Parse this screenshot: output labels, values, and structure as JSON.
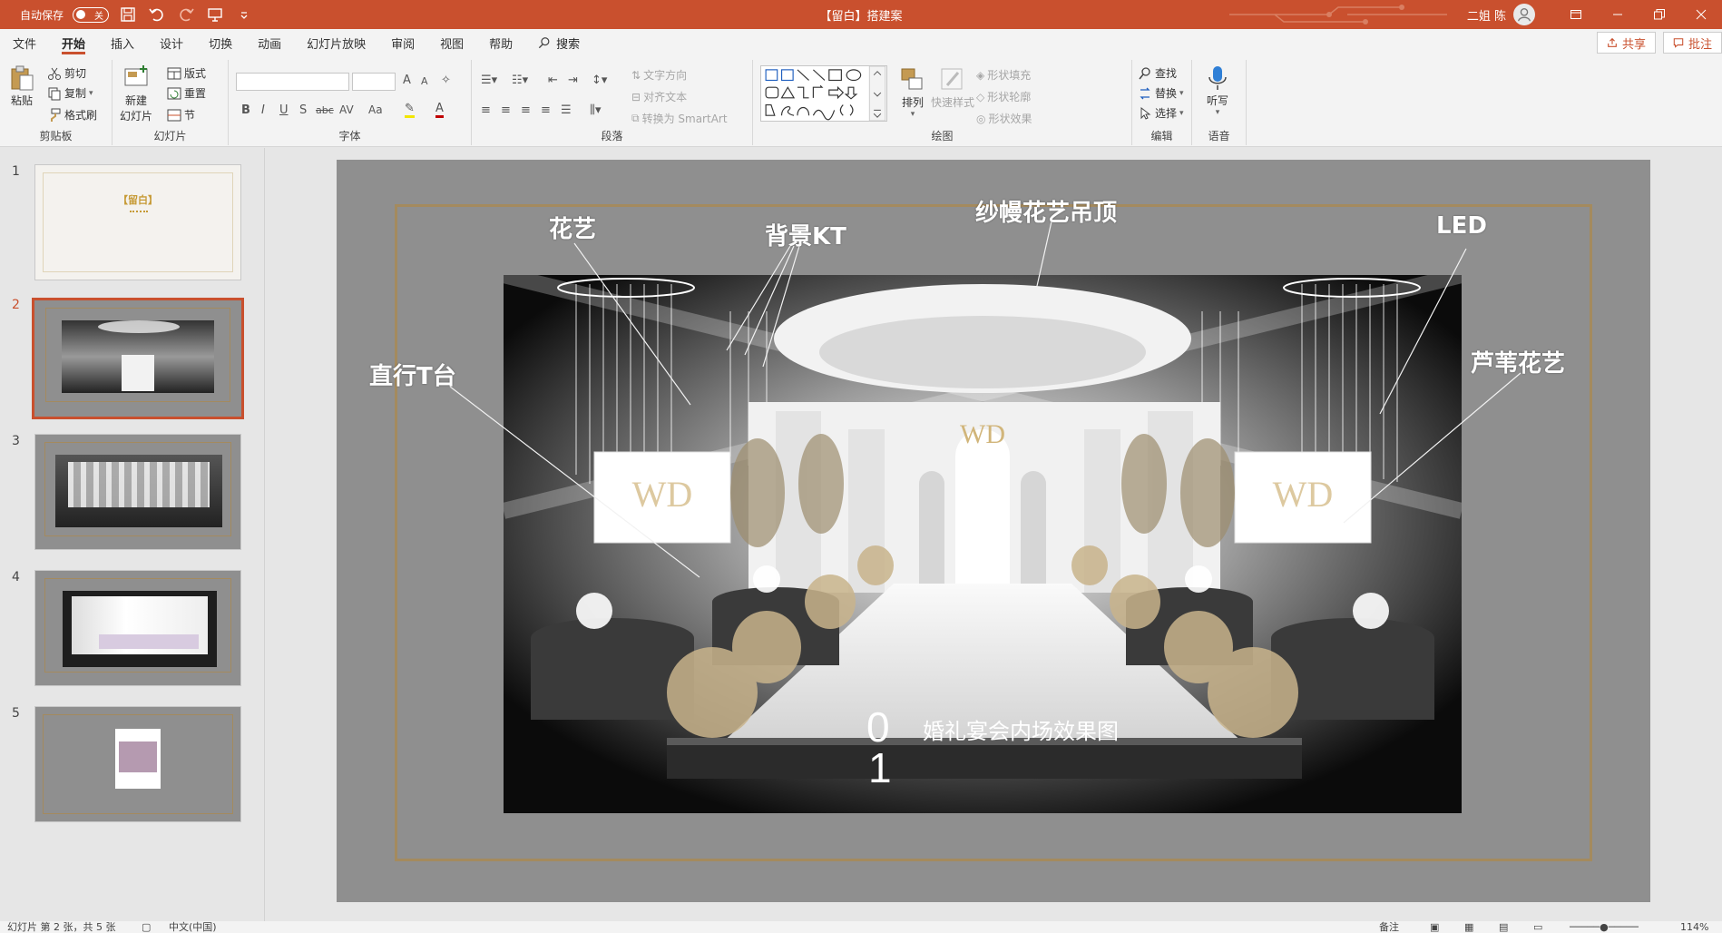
{
  "titlebar": {
    "autosave_label": "自动保存",
    "autosave_state": "关",
    "doc_title": "【留白】搭建案",
    "user_name": "二姐 陈",
    "accent_color": "#c9502e"
  },
  "menu": {
    "tabs": [
      "文件",
      "开始",
      "插入",
      "设计",
      "切换",
      "动画",
      "幻灯片放映",
      "审阅",
      "视图",
      "帮助"
    ],
    "active_tab": "开始",
    "search_label": "搜索",
    "share_label": "共享",
    "comment_label": "批注"
  },
  "ribbon": {
    "clipboard": {
      "label": "剪贴板",
      "paste": "粘贴",
      "cut": "剪切",
      "copy": "复制",
      "format_painter": "格式刷"
    },
    "slides": {
      "label": "幻灯片",
      "new_slide": "新建",
      "new_slide2": "幻灯片",
      "layout": "版式",
      "reset": "重置",
      "section": "节"
    },
    "font": {
      "label": "字体",
      "bold": "B",
      "italic": "I",
      "underline": "U",
      "shadow": "S",
      "strike": "abc",
      "spacing": "AV",
      "case": "Aa",
      "grow": "A",
      "shrink": "A"
    },
    "paragraph": {
      "label": "段落",
      "text_direction": "文字方向",
      "align_text": "对齐文本",
      "smartart": "转换为 SmartArt"
    },
    "drawing": {
      "label": "绘图",
      "arrange": "排列",
      "quick_styles": "快速样式",
      "shape_fill": "形状填充",
      "shape_outline": "形状轮廓",
      "shape_effects": "形状效果"
    },
    "editing": {
      "label": "编辑",
      "find": "查找",
      "replace": "替换",
      "select": "选择"
    },
    "voice": {
      "label": "语音",
      "dictate": "听写"
    }
  },
  "thumbnails": [
    {
      "number": "1",
      "title": "【留白】"
    },
    {
      "number": "2",
      "selected": true
    },
    {
      "number": "3"
    },
    {
      "number": "4"
    },
    {
      "number": "5"
    }
  ],
  "slide": {
    "labels": {
      "flower": "花艺",
      "backdrop": "背景KT",
      "ceiling": "纱幔花艺吊顶",
      "led": "LED",
      "runway": "直行T台",
      "reed": "芦苇花艺"
    },
    "number_top": "0",
    "number_bottom": "1",
    "caption": "婚礼宴会内场效果图"
  },
  "statusbar": {
    "slide_info": "幻灯片 第 2 张，共 5 张",
    "language": "中文(中国)",
    "notes": "备注",
    "zoom": "114%"
  }
}
